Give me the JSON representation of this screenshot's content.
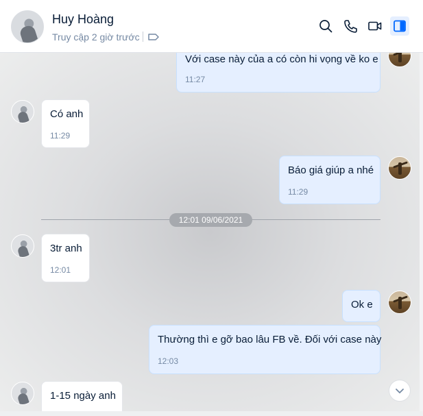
{
  "header": {
    "name": "Huy Hoàng",
    "status": "Truy cập 2 giờ trước"
  },
  "messages": [
    {
      "text": "Với case này của a có còn hi vọng về ko e",
      "time": "11:27"
    },
    {
      "text": "Có anh",
      "time": "11:29"
    },
    {
      "text": "Báo giá giúp a nhé",
      "time": "11:29"
    },
    {
      "text": "3tr anh",
      "time": "12:01"
    },
    {
      "text": "Ok e"
    },
    {
      "text": "Thường thì e gỡ bao lâu FB về. Đối với case này",
      "time": "12:03"
    },
    {
      "text": "1-15 ngày anh"
    }
  ],
  "divider": {
    "label": "12:01 09/06/2021"
  },
  "icons": {
    "search": "search-icon",
    "call": "phone-icon",
    "video": "video-call-icon",
    "panel": "conversation-info-icon",
    "tag": "tag-icon",
    "scroll": "chevron-down-icon"
  },
  "colors": {
    "accent": "#0068ff",
    "outgoing_bubble": "#e5efff",
    "incoming_bubble": "#ffffff"
  }
}
